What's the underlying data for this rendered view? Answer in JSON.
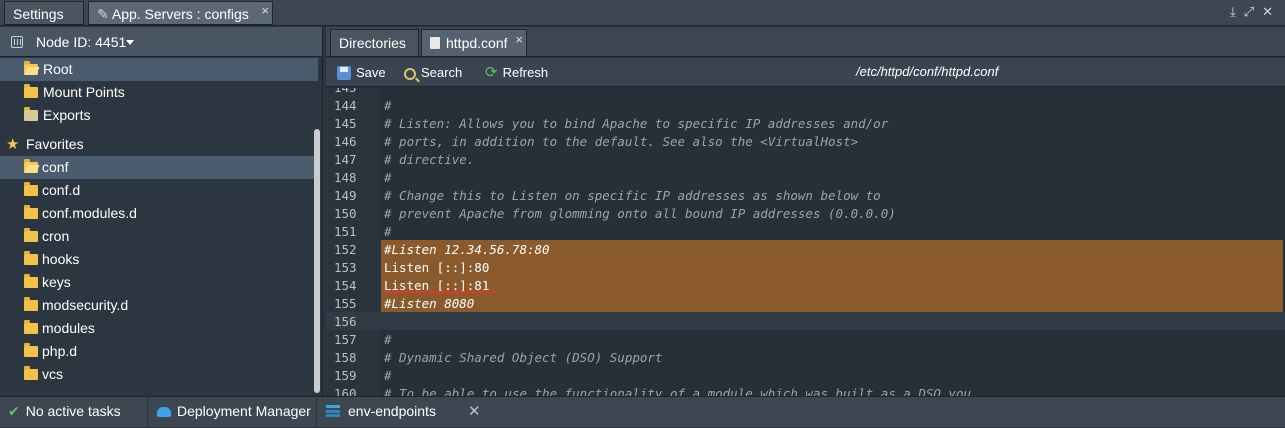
{
  "top_tabs": [
    {
      "label": "Settings"
    },
    {
      "label": "App. Servers : configs"
    }
  ],
  "top_icons": [
    "download-icon",
    "expand-icon",
    "close-icon"
  ],
  "node": {
    "label": "Node ID: 4451"
  },
  "tree": {
    "roots": [
      {
        "label": "Root"
      },
      {
        "label": "Mount Points"
      },
      {
        "label": "Exports"
      }
    ],
    "favorites_label": "Favorites",
    "folders": [
      {
        "label": "conf"
      },
      {
        "label": "conf.d"
      },
      {
        "label": "conf.modules.d"
      },
      {
        "label": "cron"
      },
      {
        "label": "hooks"
      },
      {
        "label": "keys"
      },
      {
        "label": "modsecurity.d"
      },
      {
        "label": "modules"
      },
      {
        "label": "php.d"
      },
      {
        "label": "vcs"
      }
    ]
  },
  "editor_tabs": [
    {
      "label": "Directories"
    },
    {
      "label": "httpd.conf"
    }
  ],
  "toolbar": {
    "save": "Save",
    "search": "Search",
    "refresh": "Refresh",
    "path": "/etc/httpd/conf/httpd.conf"
  },
  "code_lines": [
    {
      "num": "145",
      "text": "",
      "type": "comment"
    },
    {
      "num": "144",
      "text": "#",
      "type": "comment"
    },
    {
      "num": "145",
      "text": "# Listen: Allows you to bind Apache to specific IP addresses and/or",
      "type": "comment"
    },
    {
      "num": "146",
      "text": "# ports, in addition to the default. See also the <VirtualHost>",
      "type": "comment"
    },
    {
      "num": "147",
      "text": "# directive.",
      "type": "comment"
    },
    {
      "num": "148",
      "text": "#",
      "type": "comment"
    },
    {
      "num": "149",
      "text": "# Change this to Listen on specific IP addresses as shown below to",
      "type": "comment"
    },
    {
      "num": "150",
      "text": "# prevent Apache from glomming onto all bound IP addresses (0.0.0.0)",
      "type": "comment"
    },
    {
      "num": "151",
      "text": "#",
      "type": "comment"
    },
    {
      "num": "152",
      "text": "#Listen 12.34.56.78:80",
      "type": "comment"
    },
    {
      "num": "153",
      "text": "Listen [::]:80",
      "type": "plain"
    },
    {
      "num": "154",
      "text": "Listen [::]:81",
      "type": "plain"
    },
    {
      "num": "155",
      "text": "#Listen 8080",
      "type": "comment"
    },
    {
      "num": "156",
      "text": "",
      "type": "plain"
    },
    {
      "num": "157",
      "text": "#",
      "type": "comment"
    },
    {
      "num": "158",
      "text": "# Dynamic Shared Object (DSO) Support",
      "type": "comment"
    },
    {
      "num": "159",
      "text": "#",
      "type": "comment"
    },
    {
      "num": "160",
      "text": "# To be able to use the functionality of a module which was built as a DSO you",
      "type": "comment"
    }
  ],
  "bottom": {
    "tasks": "No active tasks",
    "deployment": "Deployment Manager",
    "env": "env-endpoints"
  },
  "colors": {
    "highlight": "#8a5a2c",
    "underline": "#e8332a",
    "accent": "#3fa3e8"
  }
}
